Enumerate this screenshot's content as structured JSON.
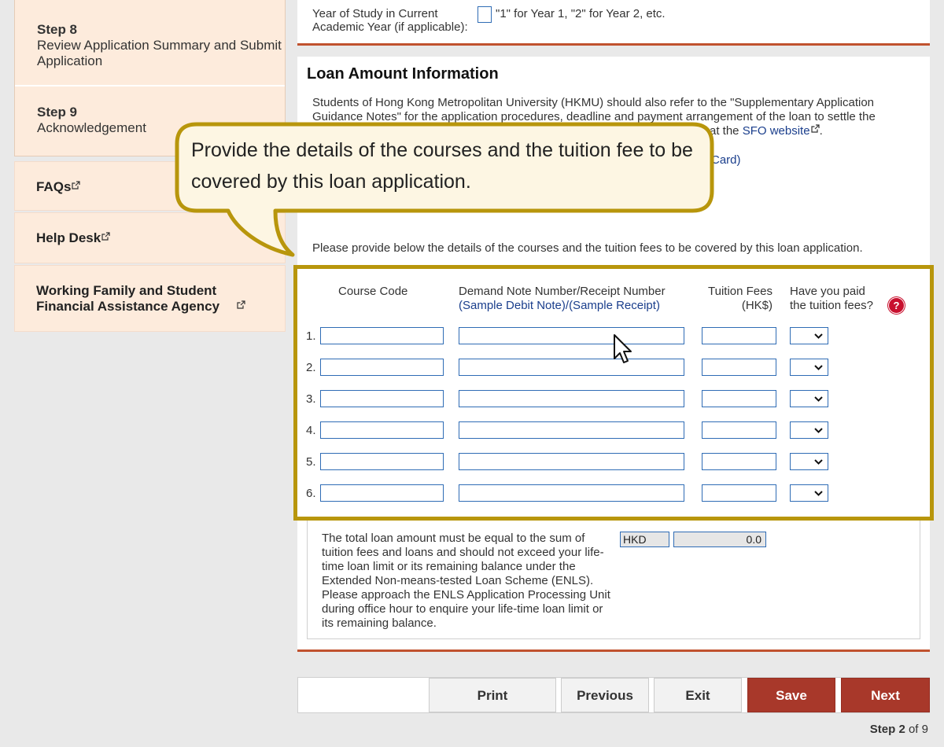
{
  "sidebar": {
    "steps": [
      {
        "num": "Step 8",
        "title": "Review Application Summary and Submit Application"
      },
      {
        "num": "Step 9",
        "title": "Acknowledgement"
      }
    ],
    "links": [
      {
        "label": "FAQs"
      },
      {
        "label": "Help Desk"
      },
      {
        "label": "Working Family and Student Financial Assistance Agency"
      }
    ]
  },
  "year_of_study": {
    "label": "Year of Study in Current Academic Year (if applicable):",
    "value": "",
    "hint": "\"1\" for Year 1, \"2\" for Year 2, etc."
  },
  "loan": {
    "heading": "Loan Amount Information",
    "para_before": "Students of Hong Kong Metropolitan University (HKMU) should also refer to the \"Supplementary Application Guidance Notes\" for the application procedures, deadline and payment arrangement of the loan to settle the",
    "para_after_fragment": "at the",
    "sfo_link": "SFO website",
    "card_fragment": "Card)",
    "provide_text": "Please provide below the details of the courses and the tuition fees to be covered by this loan application.",
    "headers": {
      "course_code": "Course Code",
      "demand_note": "Demand Note Number/Receipt Number",
      "sample_debit": "(Sample Debit Note)",
      "sample_receipt": "(Sample Receipt)",
      "tuition_fees": "Tuition Fees",
      "currency": "(HK$)",
      "paid_line1": "Have you paid",
      "paid_line2": "the tuition fees?",
      "help_glyph": "?"
    },
    "rows": [
      {
        "num": "1.",
        "course": "",
        "note": "",
        "fee": "",
        "paid": ""
      },
      {
        "num": "2.",
        "course": "",
        "note": "",
        "fee": "",
        "paid": ""
      },
      {
        "num": "3.",
        "course": "",
        "note": "",
        "fee": "",
        "paid": ""
      },
      {
        "num": "4.",
        "course": "",
        "note": "",
        "fee": "",
        "paid": ""
      },
      {
        "num": "5.",
        "course": "",
        "note": "",
        "fee": "",
        "paid": ""
      },
      {
        "num": "6.",
        "course": "",
        "note": "",
        "fee": "",
        "paid": ""
      }
    ],
    "total_text": "The total loan amount must be equal to the sum of tuition fees and loans and should not exceed your life-time loan limit or its remaining balance under the Extended Non-means-tested Loan Scheme (ENLS). Please approach the ENLS Application Processing Unit during office hour to enquire your life-time loan limit or its remaining balance.",
    "currency_code": "HKD",
    "total_amount": "0.0"
  },
  "buttons": {
    "print": "Print",
    "previous": "Previous",
    "exit": "Exit",
    "save": "Save",
    "next": "Next"
  },
  "step_counter": {
    "word": "Step",
    "current": "2",
    "of": "of",
    "total": "9"
  },
  "callout": {
    "text": "Provide the details of the courses and the tuition fee to be covered by this loan application."
  },
  "colors": {
    "accent_red": "#a8382a",
    "rule_orange": "#c0522e",
    "highlight_gold": "#b8960c",
    "sidebar_bg": "#fdebdc",
    "link_blue": "#1a3e8c"
  },
  "icons": [
    "external-link-icon",
    "help-icon",
    "chevron-down-icon",
    "mouse-cursor-icon"
  ]
}
